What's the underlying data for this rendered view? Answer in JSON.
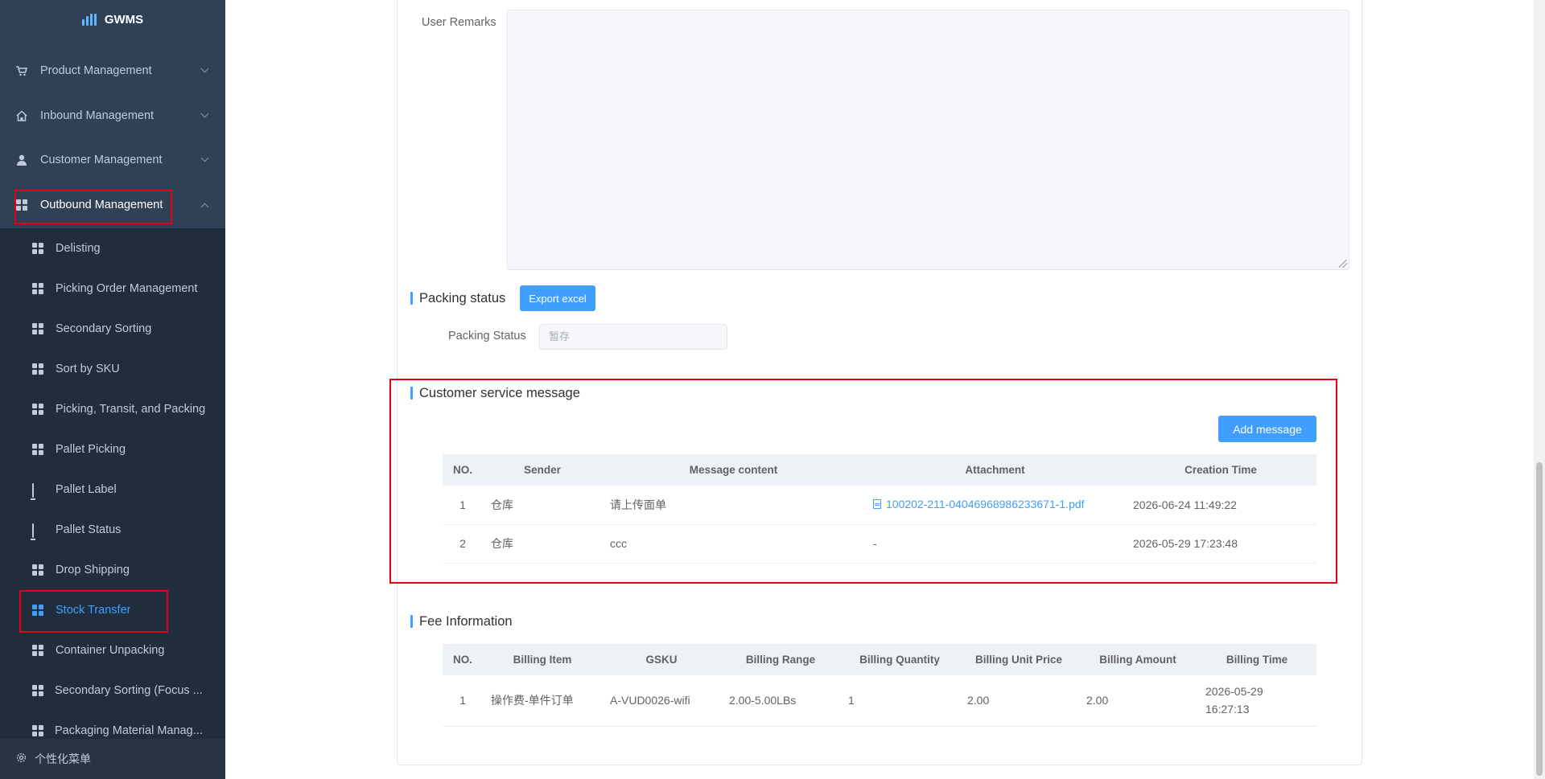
{
  "app": {
    "title": "GWMS"
  },
  "sidebar": {
    "menu": [
      {
        "label": "Product Management",
        "icon": "cart-icon"
      },
      {
        "label": "Inbound Management",
        "icon": "home-icon"
      },
      {
        "label": "Customer Management",
        "icon": "user-icon"
      },
      {
        "label": "Outbound Management",
        "icon": "grid-icon"
      }
    ],
    "submenu": [
      {
        "label": "Delisting"
      },
      {
        "label": "Picking Order Management"
      },
      {
        "label": "Secondary Sorting"
      },
      {
        "label": "Sort by SKU"
      },
      {
        "label": "Picking, Transit, and Packing"
      },
      {
        "label": "Pallet Picking"
      },
      {
        "label": "Pallet Label"
      },
      {
        "label": "Pallet Status"
      },
      {
        "label": "Drop Shipping"
      },
      {
        "label": "Stock Transfer"
      },
      {
        "label": "Container Unpacking"
      },
      {
        "label": "Secondary Sorting (Focus ..."
      },
      {
        "label": "Packaging Material Manag..."
      }
    ],
    "footer": "个性化菜单"
  },
  "form": {
    "user_remarks_label": "User Remarks",
    "user_remarks_value": ""
  },
  "packing": {
    "title": "Packing status",
    "export_button": "Export excel",
    "status_label": "Packing Status",
    "status_placeholder": "暂存"
  },
  "messages": {
    "title": "Customer service message",
    "add_button": "Add message",
    "columns": [
      "NO.",
      "Sender",
      "Message content",
      "Attachment",
      "Creation Time"
    ],
    "rows": [
      {
        "no": "1",
        "sender": "仓库",
        "content": "请上传面单",
        "attachment": "100202-211-04046968986233671-1.pdf",
        "time": "2026-06-24 11:49:22"
      },
      {
        "no": "2",
        "sender": "仓库",
        "content": "ccc",
        "attachment": "-",
        "time": "2026-05-29 17:23:48"
      }
    ]
  },
  "fees": {
    "title": "Fee Information",
    "columns": [
      "NO.",
      "Billing Item",
      "GSKU",
      "Billing Range",
      "Billing Quantity",
      "Billing Unit Price",
      "Billing Amount",
      "Billing Time"
    ],
    "rows": [
      {
        "no": "1",
        "item": "操作费-单件订单",
        "gsku": "A-VUD0026-wifi",
        "range": "2.00-5.00LBs",
        "qty": "1",
        "unit_price": "2.00",
        "amount": "2.00",
        "time": "2026-05-29 16:27:13"
      }
    ]
  }
}
